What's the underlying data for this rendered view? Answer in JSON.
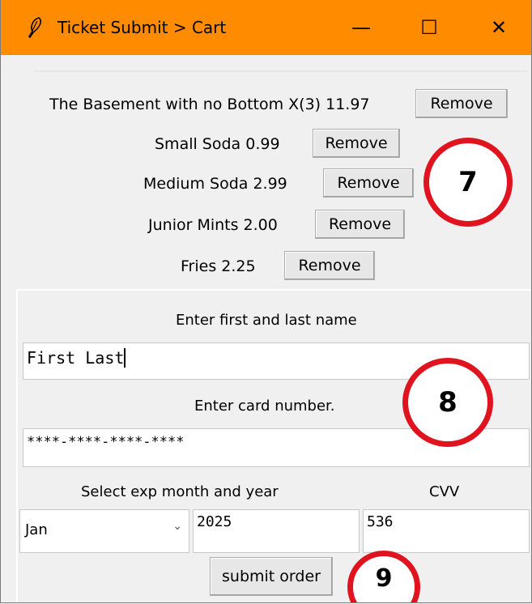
{
  "window": {
    "title": "Ticket Submit > Cart",
    "min_glyph": "—",
    "max_glyph": "☐",
    "close_glyph": "✕",
    "accent": "#ff8c00"
  },
  "cart": {
    "items": [
      {
        "text": "The Basement with no Bottom X(3)   11.97",
        "button": "Remove"
      },
      {
        "text": "Small Soda   0.99",
        "button": "Remove"
      },
      {
        "text": "Medium Soda   2.99",
        "button": "Remove"
      },
      {
        "text": "Junior Mints   2.00",
        "button": "Remove"
      },
      {
        "text": "Fries   2.25",
        "button": "Remove"
      }
    ]
  },
  "form": {
    "name_label": "Enter first and last name",
    "name_value": "First Last",
    "card_label": "Enter card number.",
    "card_value": "****-****-****-****",
    "exp_label": "Select exp month and year",
    "cvv_label": "CVV",
    "month_value": "Jan",
    "year_value": "2025",
    "cvv_value": "536",
    "submit_label": "submit order"
  },
  "annotations": {
    "a7": "7",
    "a8": "8",
    "a9": "9",
    "color": "#e0141e"
  }
}
